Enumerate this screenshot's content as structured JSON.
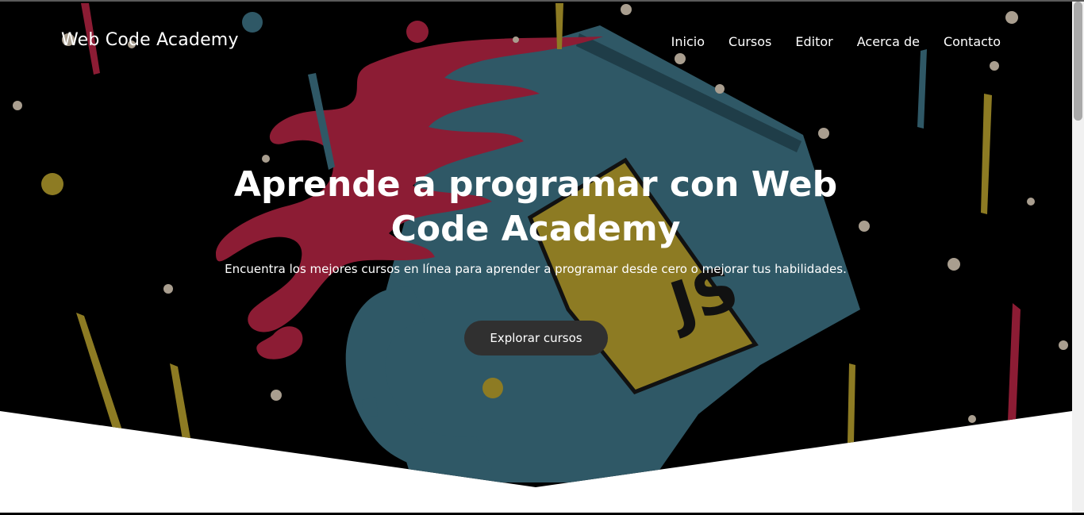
{
  "brand": {
    "name": "Web Code Academy"
  },
  "nav": {
    "items": [
      {
        "label": "Inicio"
      },
      {
        "label": "Cursos"
      },
      {
        "label": "Editor"
      },
      {
        "label": "Acerca de"
      },
      {
        "label": "Contacto"
      }
    ]
  },
  "hero": {
    "title": "Aprende a programar con Web Code Academy",
    "subtitle": "Encuentra los mejores cursos en línea para aprender a programar desde cero o mejorar tus habilidades.",
    "cta_label": "Explorar cursos",
    "illustration": {
      "mug_label": "JS",
      "colors": {
        "mug": "#2f5866",
        "badge": "#8d7b23",
        "splash": "#8c1c34",
        "speck": "#a99e8f",
        "background": "#000000"
      }
    }
  }
}
